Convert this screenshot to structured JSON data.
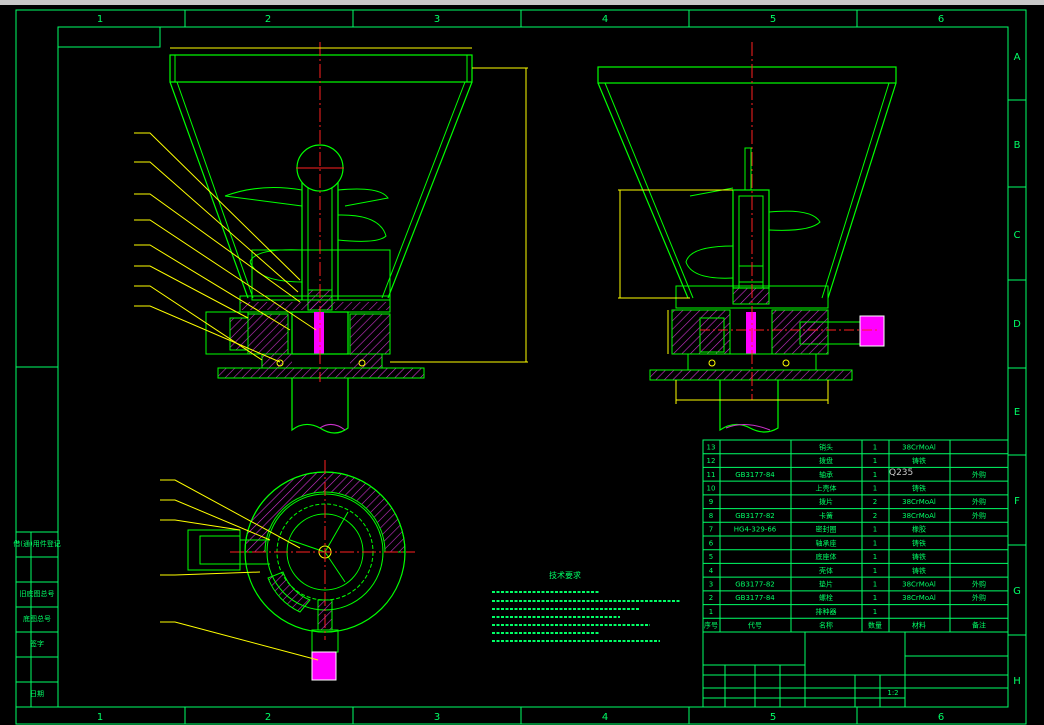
{
  "drawing": {
    "zone_columns": [
      "1",
      "2",
      "3",
      "4",
      "5",
      "6"
    ],
    "zone_rows": [
      "A",
      "B",
      "C",
      "D",
      "E",
      "F",
      "G",
      "H"
    ],
    "material_callout": "Q235",
    "notes_title": "技术要求",
    "title_block_scale": "1:2"
  },
  "bom_rows": [
    {
      "no": "13",
      "code": "",
      "name": "销头",
      "qty": "1",
      "material": "38CrMoAl",
      "remark": ""
    },
    {
      "no": "12",
      "code": "",
      "name": "拨盘",
      "qty": "1",
      "material": "铸铁",
      "remark": ""
    },
    {
      "no": "11",
      "code": "GB3177-84",
      "name": "轴承",
      "qty": "1",
      "material": "",
      "remark": "外购"
    },
    {
      "no": "10",
      "code": "",
      "name": "上壳体",
      "qty": "1",
      "material": "铸铁",
      "remark": ""
    },
    {
      "no": "9",
      "code": "",
      "name": "拨片",
      "qty": "2",
      "material": "38CrMoAl",
      "remark": "外购"
    },
    {
      "no": "8",
      "code": "GB3177-82",
      "name": "卡簧",
      "qty": "2",
      "material": "38CrMoAl",
      "remark": "外购"
    },
    {
      "no": "7",
      "code": "HG4-329-66",
      "name": "密封圈",
      "qty": "1",
      "material": "橡胶",
      "remark": ""
    },
    {
      "no": "6",
      "code": "",
      "name": "轴承座",
      "qty": "1",
      "material": "铸铁",
      "remark": ""
    },
    {
      "no": "5",
      "code": "",
      "name": "底座体",
      "qty": "1",
      "material": "铸铁",
      "remark": ""
    },
    {
      "no": "4",
      "code": "",
      "name": "壳体",
      "qty": "1",
      "material": "铸铁",
      "remark": ""
    },
    {
      "no": "3",
      "code": "GB3177-82",
      "name": "垫片",
      "qty": "1",
      "material": "38CrMoAl",
      "remark": "外购"
    },
    {
      "no": "2",
      "code": "GB3177-84",
      "name": "螺栓",
      "qty": "1",
      "material": "38CrMoAl",
      "remark": "外购"
    },
    {
      "no": "1",
      "code": "",
      "name": "排种器",
      "qty": "1",
      "material": "",
      "remark": ""
    }
  ],
  "bom_header": {
    "no": "序号",
    "code": "代号",
    "name": "名称",
    "qty": "数量",
    "material": "材料",
    "remark": "备注"
  },
  "left_strip_labels": [
    "借(通)用件登记",
    "旧底图总号",
    "底图总号",
    "签字",
    "日期"
  ],
  "colors": {
    "frame": "#00ff66",
    "object": "#00ff00",
    "centerline": "#ff2020",
    "dimension": "#ffff00",
    "hatch": "#cc33cc",
    "highlight": "#ff00ff",
    "white": "#ffffff"
  }
}
